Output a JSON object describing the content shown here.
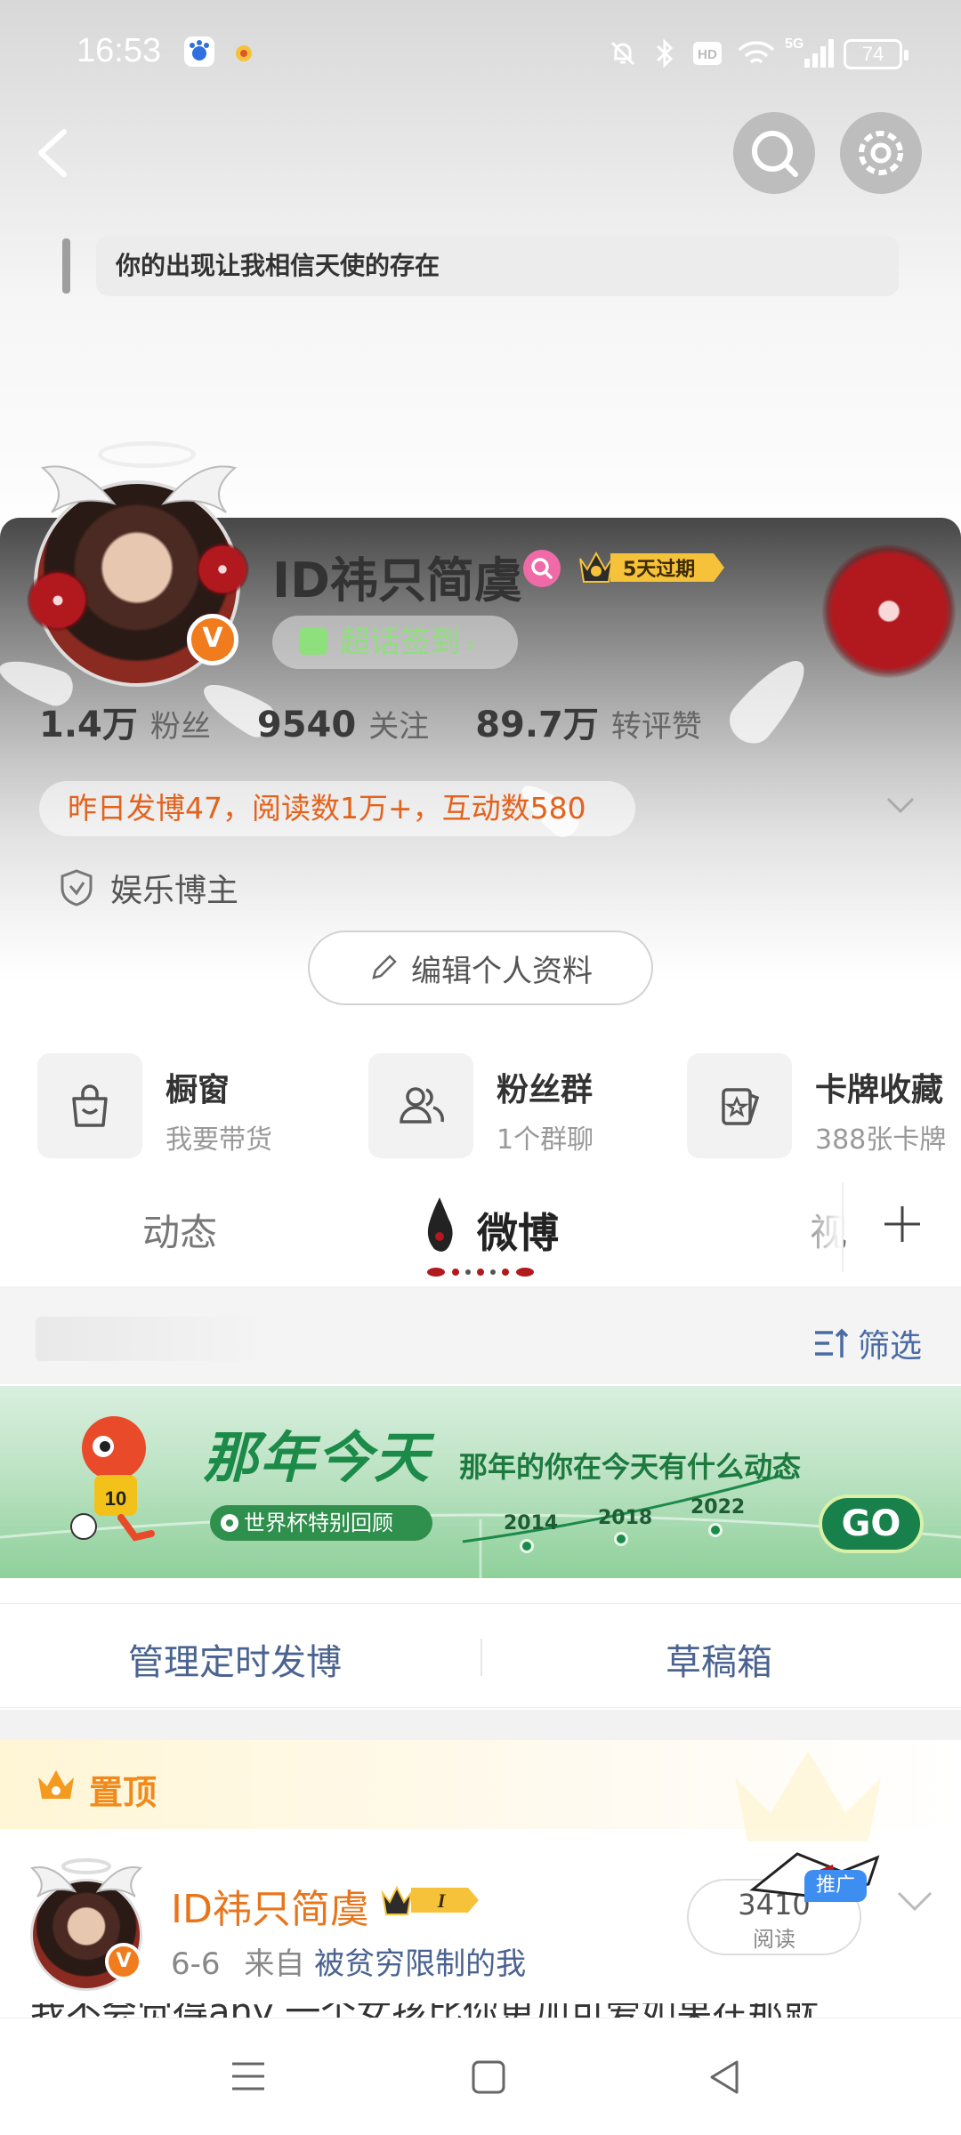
{
  "status_bar": {
    "time": "16:53",
    "battery": "74",
    "icons": [
      "baidu-app-icon",
      "notification-app-icon",
      "mute-icon",
      "bluetooth-icon",
      "hd-icon",
      "wifi-icon",
      "5g-signal-icon",
      "battery-icon"
    ]
  },
  "header": {
    "back_icon": "back-arrow-icon",
    "search_icon": "search-icon",
    "settings_icon": "gear-icon",
    "signature": "你的出现让我相信天使的存在"
  },
  "profile": {
    "name": "ID祎只简虞",
    "vip_badge": "5天过期",
    "checkin_label": "超话签到",
    "stats": [
      {
        "value": "1.4万",
        "label": "粉丝"
      },
      {
        "value": "9540",
        "label": "关注"
      },
      {
        "value": "89.7万",
        "label": "转评赞"
      }
    ],
    "summary": "昨日发博47，阅读数1万+，互动数580",
    "tag": "娱乐博主",
    "edit_label": "编辑个人资料"
  },
  "quick_entries": [
    {
      "title": "橱窗",
      "sub": "我要带货"
    },
    {
      "title": "粉丝群",
      "sub": "1个群聊"
    },
    {
      "title": "卡牌收藏",
      "sub": "388张卡牌"
    }
  ],
  "tabs": {
    "items": [
      "动态",
      "微博",
      "视"
    ],
    "active": "微博"
  },
  "filter": {
    "label": "筛选"
  },
  "banner": {
    "title": "那年今天",
    "subtitle": "那年的你在今天有什么动态",
    "pill": "世界杯特别回顾",
    "years": [
      "2014",
      "2018",
      "2022"
    ],
    "go": "GO",
    "mascot_number": "10"
  },
  "actions": {
    "scheduled": "管理定时发博",
    "drafts": "草稿箱"
  },
  "pinned": {
    "label": "置顶"
  },
  "post": {
    "author": "ID祎只简虞",
    "vip_level": "I",
    "date": "6-6",
    "from_prefix": "来自",
    "source": "被贫穷限制的我",
    "reads": "3410",
    "reads_label": "阅读",
    "promo": "推广",
    "text_peek": "我不会觉得any 一个女孩比你更加可爱如果在那就"
  },
  "colors": {
    "accent_orange": "#e8751b",
    "link_blue": "#4a6390",
    "checkin_green": "#8ee07c",
    "banner_green": "#1c8a48"
  }
}
